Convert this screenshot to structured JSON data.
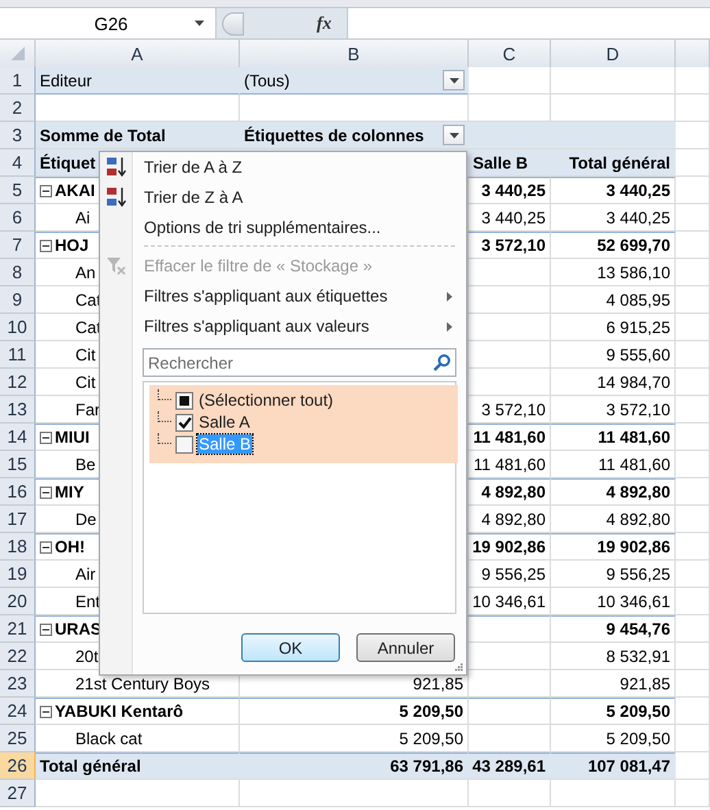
{
  "name_box": {
    "value": "G26"
  },
  "formula_bar": {
    "function_button": "fx"
  },
  "column_headers": [
    {
      "label": "A"
    },
    {
      "label": "B"
    },
    {
      "label": "C"
    },
    {
      "label": "D"
    }
  ],
  "rows": [
    {
      "number": "1",
      "selected": false,
      "kind": "page_field",
      "cells": [
        "Editeur",
        "(Tous)",
        "",
        ""
      ]
    },
    {
      "number": "2",
      "selected": false,
      "kind": "blank",
      "cells": [
        "",
        "",
        "",
        ""
      ]
    },
    {
      "number": "3",
      "selected": false,
      "kind": "header",
      "cells": [
        "Somme de Total",
        "Étiquettes de colonnes",
        "",
        ""
      ]
    },
    {
      "number": "4",
      "selected": false,
      "kind": "subheader",
      "cells": [
        "Étiquet",
        "",
        "Salle B",
        "Total général"
      ]
    },
    {
      "number": "5",
      "selected": false,
      "kind": "group",
      "cells": [
        "AKAI",
        "",
        "3 440,25",
        "3 440,25"
      ]
    },
    {
      "number": "6",
      "selected": false,
      "kind": "item",
      "cells": [
        "Ai",
        "",
        "3 440,25",
        "3 440,25"
      ]
    },
    {
      "number": "7",
      "selected": false,
      "kind": "group",
      "cells": [
        "HOJ",
        "",
        "3 572,10",
        "52 699,70"
      ]
    },
    {
      "number": "8",
      "selected": false,
      "kind": "item",
      "cells": [
        "An",
        "",
        "",
        "13 586,10"
      ]
    },
    {
      "number": "9",
      "selected": false,
      "kind": "item",
      "cells": [
        "Cat",
        "",
        "",
        "4 085,95"
      ]
    },
    {
      "number": "10",
      "selected": false,
      "kind": "item",
      "cells": [
        "Cat",
        "",
        "",
        "6 915,25"
      ]
    },
    {
      "number": "11",
      "selected": false,
      "kind": "item",
      "cells": [
        "Cit",
        "",
        "",
        "9 555,60"
      ]
    },
    {
      "number": "12",
      "selected": false,
      "kind": "item",
      "cells": [
        "Cit",
        "",
        "",
        "14 984,70"
      ]
    },
    {
      "number": "13",
      "selected": false,
      "kind": "item",
      "cells": [
        "Far",
        "",
        "3 572,10",
        "3 572,10"
      ]
    },
    {
      "number": "14",
      "selected": false,
      "kind": "group",
      "cells": [
        "MIUI",
        "",
        "11 481,60",
        "11 481,60"
      ]
    },
    {
      "number": "15",
      "selected": false,
      "kind": "item",
      "cells": [
        "Be",
        "",
        "11 481,60",
        "11 481,60"
      ]
    },
    {
      "number": "16",
      "selected": false,
      "kind": "group",
      "cells": [
        "MIY",
        "",
        "4 892,80",
        "4 892,80"
      ]
    },
    {
      "number": "17",
      "selected": false,
      "kind": "item",
      "cells": [
        "De",
        "",
        "4 892,80",
        "4 892,80"
      ]
    },
    {
      "number": "18",
      "selected": false,
      "kind": "group",
      "cells": [
        "OH!",
        "",
        "19 902,86",
        "19 902,86"
      ]
    },
    {
      "number": "19",
      "selected": false,
      "kind": "item",
      "cells": [
        "Air",
        "",
        "9 556,25",
        "9 556,25"
      ]
    },
    {
      "number": "20",
      "selected": false,
      "kind": "item",
      "cells": [
        "Ent",
        "",
        "10 346,61",
        "10 346,61"
      ]
    },
    {
      "number": "21",
      "selected": false,
      "kind": "group",
      "cells": [
        "URAS",
        "",
        "",
        "9 454,76"
      ]
    },
    {
      "number": "22",
      "selected": false,
      "kind": "item",
      "cells": [
        "20t",
        "",
        "",
        "8 532,91"
      ]
    },
    {
      "number": "23",
      "selected": false,
      "kind": "item",
      "cells": [
        "21st Century Boys",
        "921,85",
        "",
        "921,85"
      ]
    },
    {
      "number": "24",
      "selected": false,
      "kind": "group",
      "cells": [
        "YABUKI Kentarô",
        "5 209,50",
        "",
        "5 209,50"
      ]
    },
    {
      "number": "25",
      "selected": false,
      "kind": "item",
      "cells": [
        "Black cat",
        "5 209,50",
        "",
        "5 209,50"
      ]
    },
    {
      "number": "26",
      "selected": true,
      "kind": "total",
      "cells": [
        "Total général",
        "63 791,86",
        "43 289,61",
        "107 081,47"
      ]
    },
    {
      "number": "27",
      "selected": false,
      "kind": "blank",
      "cells": [
        "",
        "",
        "",
        ""
      ]
    }
  ],
  "filter_menu": {
    "items": [
      {
        "kind": "sort_asc",
        "label": "Trier de A à Z",
        "disabled": false
      },
      {
        "kind": "sort_desc",
        "label": "Trier de Z à A",
        "disabled": false
      },
      {
        "kind": "command",
        "label": "Options de tri supplémentaires...",
        "disabled": false
      },
      {
        "kind": "separator"
      },
      {
        "kind": "clear_filter",
        "label": "Effacer le filtre de « Stockage »",
        "disabled": true
      },
      {
        "kind": "submenu",
        "label": "Filtres s'appliquant aux étiquettes",
        "disabled": false
      },
      {
        "kind": "submenu",
        "label": "Filtres s'appliquant aux valeurs",
        "disabled": false
      }
    ],
    "search": {
      "placeholder": "Rechercher"
    },
    "values": [
      {
        "label": "(Sélectionner tout)",
        "checked": false,
        "indeterminate": true,
        "selected": false
      },
      {
        "label": "Salle A",
        "checked": true,
        "indeterminate": false,
        "selected": false
      },
      {
        "label": "Salle B",
        "checked": false,
        "indeterminate": false,
        "selected": true
      }
    ],
    "buttons": [
      {
        "label": "OK",
        "focused": true
      },
      {
        "label": "Annuler",
        "focused": false
      }
    ]
  }
}
